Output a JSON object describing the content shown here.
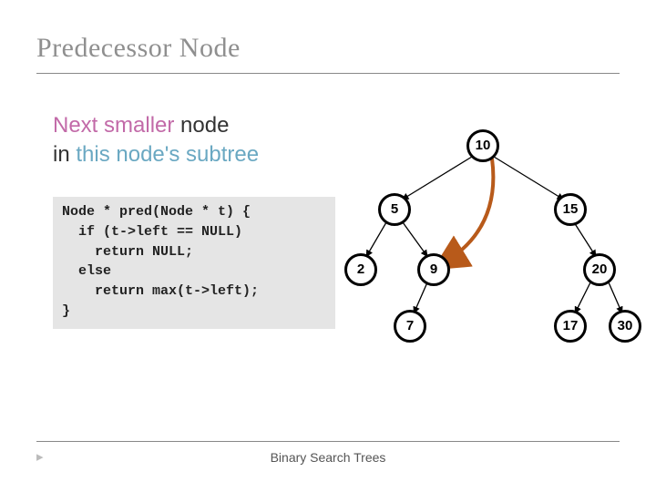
{
  "title": "Predecessor Node",
  "subtitle": {
    "part1": "Next smaller",
    "part2": " node",
    "part3": "in ",
    "part4": "this node's subtree"
  },
  "code": "Node * pred(Node * t) {\n  if (t->left == NULL)\n    return NULL;\n  else\n    return max(t->left);\n}",
  "tree": {
    "root": "10",
    "left": {
      "value": "5",
      "left": {
        "value": "2"
      },
      "right": {
        "value": "9",
        "left": {
          "value": "7"
        }
      }
    },
    "right": {
      "value": "15",
      "right": {
        "value": "20",
        "left": {
          "value": "17"
        },
        "right": {
          "value": "30"
        }
      }
    }
  },
  "arrow_note": "predecessor arrow from root 10 to node 9",
  "footer": "Binary Search Trees",
  "marker": "▸"
}
